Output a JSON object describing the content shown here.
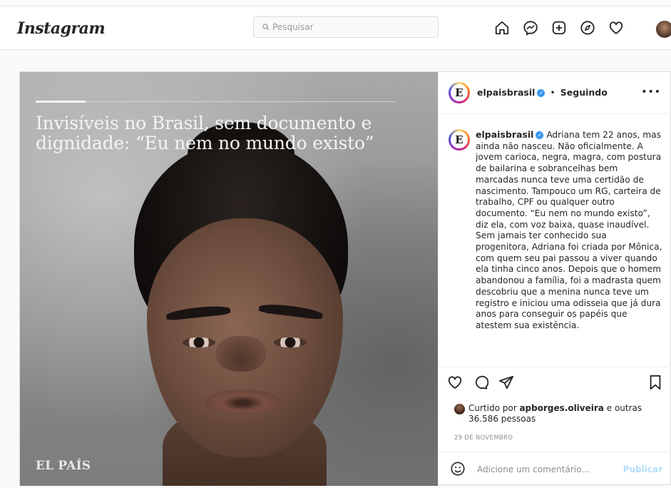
{
  "topbar": {
    "logo": "Instagram",
    "search_placeholder": "Pesquisar",
    "nav_icons": [
      "home-icon",
      "messenger-icon",
      "new-post-icon",
      "explore-icon",
      "activity-heart-icon",
      "profile-avatar"
    ]
  },
  "post": {
    "image": {
      "headline": "Invisíveis no Brasil, sem documento e dignidade: “Eu nem no mundo existo”",
      "brand": "EL PAÍS"
    },
    "header": {
      "logo_letter": "E",
      "username": "elpaisbrasil",
      "separator": "•",
      "follow_status": "Seguindo",
      "more": "•••"
    },
    "caption": {
      "username": "elpaisbrasil",
      "text": "Adriana tem 22 anos, mas ainda não nasceu. Não oficialmente. A jovem carioca, negra, magra, com postura de bailarina e sobrancelhas bem marcadas nunca teve uma certidão de nascimento. Tampouco um RG, carteira de trabalho, CPF ou qualquer outro documento. “Eu nem no mundo existo”, diz ela, com voz baixa, quase inaudível. Sem jamais ter conhecido sua progenitora, Adriana foi criada por Mônica, com quem seu pai passou a viver quando ela tinha cinco anos. Depois que o homem abandonou a família, foi a madrasta quem descobriu que a menina nunca teve um registro e iniciou uma odisseia que já dura anos para conseguir os papéis que atestem sua existência."
    },
    "likes": {
      "prefix": "Curtido por",
      "user": "apborges.oliveira",
      "suffix": "e",
      "others": "outras 36.586 pessoas"
    },
    "date": "29 DE NOVEMBRO",
    "comment": {
      "placeholder": "Adicione um comentário...",
      "publish": "Publicar"
    }
  }
}
